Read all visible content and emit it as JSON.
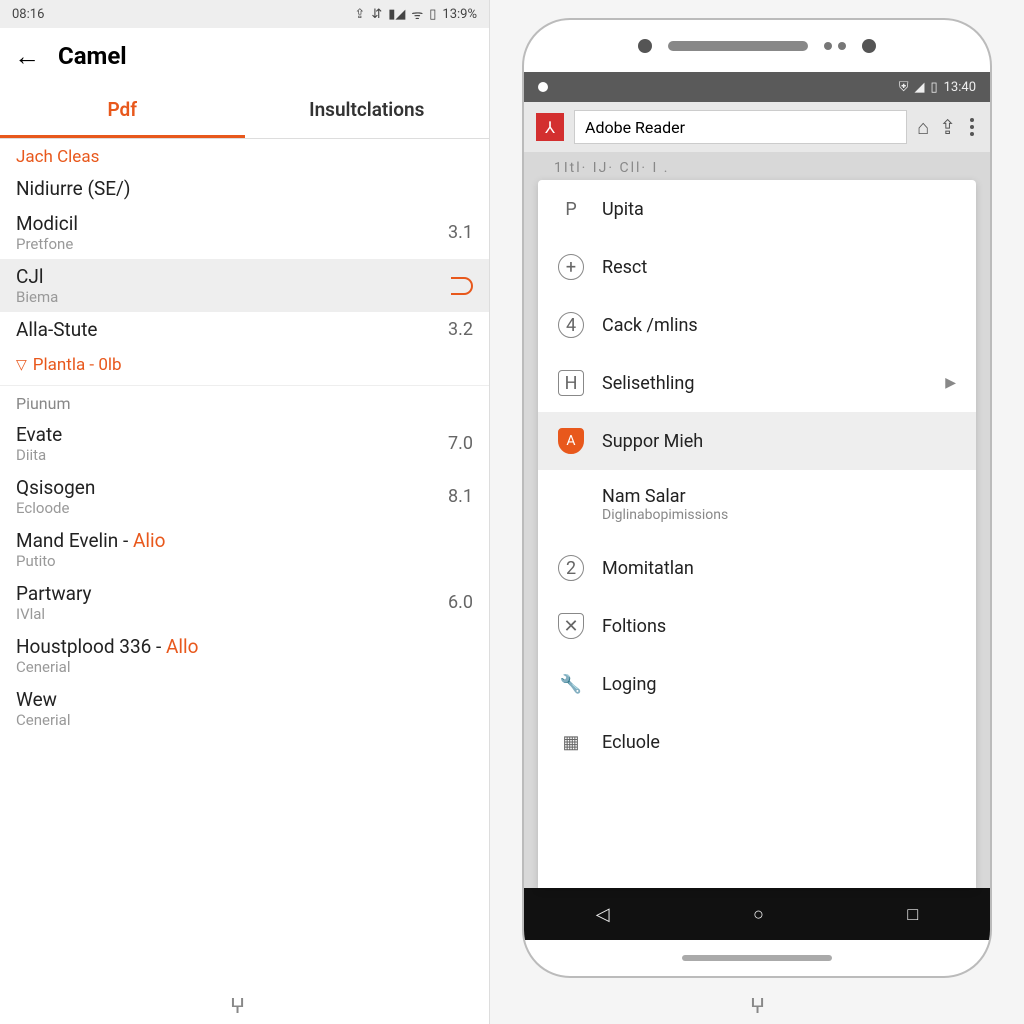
{
  "left": {
    "status": {
      "time": "08:16",
      "battery": "13:9%"
    },
    "title": "Camel",
    "tabs": {
      "active": "Pdf",
      "inactive": "Insultclations"
    },
    "section1_label": "Jach Cleas",
    "rows1": [
      {
        "title": "Nidiurre (SE/)",
        "sub": "",
        "val": ""
      },
      {
        "title": "Modicil",
        "sub": "Pretfone",
        "val": "3.1"
      }
    ],
    "row_sel": {
      "title": "CJl",
      "sub": "Biema"
    },
    "rows1b": [
      {
        "title": "Alla-Stute",
        "sub": "",
        "val": "3.2"
      }
    ],
    "section2_label": "Plantla - 0lb",
    "section2_sub": "Piunum",
    "rows2": [
      {
        "title": "Evate",
        "sub": "Diita",
        "val": "7.0"
      },
      {
        "title": "Qsisogen",
        "sub": "Ecloode",
        "val": "8.1"
      }
    ],
    "section3_label_a": "Mand Evelin - ",
    "section3_label_b": "Alio",
    "section3_sub": "Putito",
    "rows3": [
      {
        "title": "Partwary",
        "sub": "IVlal",
        "val": "6.0"
      }
    ],
    "section4_label_a": "Houstplood 336  - ",
    "section4_label_b": "Allo",
    "section4_sub": "Cenerial",
    "rows4": [
      {
        "title": "Wew",
        "sub": "Cenerial",
        "val": ""
      }
    ]
  },
  "right": {
    "status_time": "13:40",
    "app_name": "Adobe Reader",
    "peek_text": "1Itl· IJ· Cll· I .",
    "menu": [
      {
        "icon": "P",
        "label": "Upita",
        "style": "plain"
      },
      {
        "icon": "+",
        "label": "Resct",
        "style": "circle"
      },
      {
        "icon": "4",
        "label": "Cack /mlins",
        "style": "circle"
      },
      {
        "icon": "H",
        "label": "Selisethling",
        "style": "box",
        "chev": true
      },
      {
        "icon": "A",
        "label": "Suppor Mieh",
        "style": "shield",
        "sel": true
      },
      {
        "icon": "",
        "label": "Nam Salar",
        "sub": "Diglinabopimissions",
        "style": "none"
      },
      {
        "icon": "2",
        "label": "Momitatlan",
        "style": "circle"
      },
      {
        "icon": "✕",
        "label": "Foltions",
        "style": "shield-outline"
      },
      {
        "icon": "🔧",
        "label": "Loging",
        "style": "plain"
      },
      {
        "icon": "▦",
        "label": "Ecluole",
        "style": "plain"
      }
    ]
  },
  "footer_glyph": "ⵖ"
}
